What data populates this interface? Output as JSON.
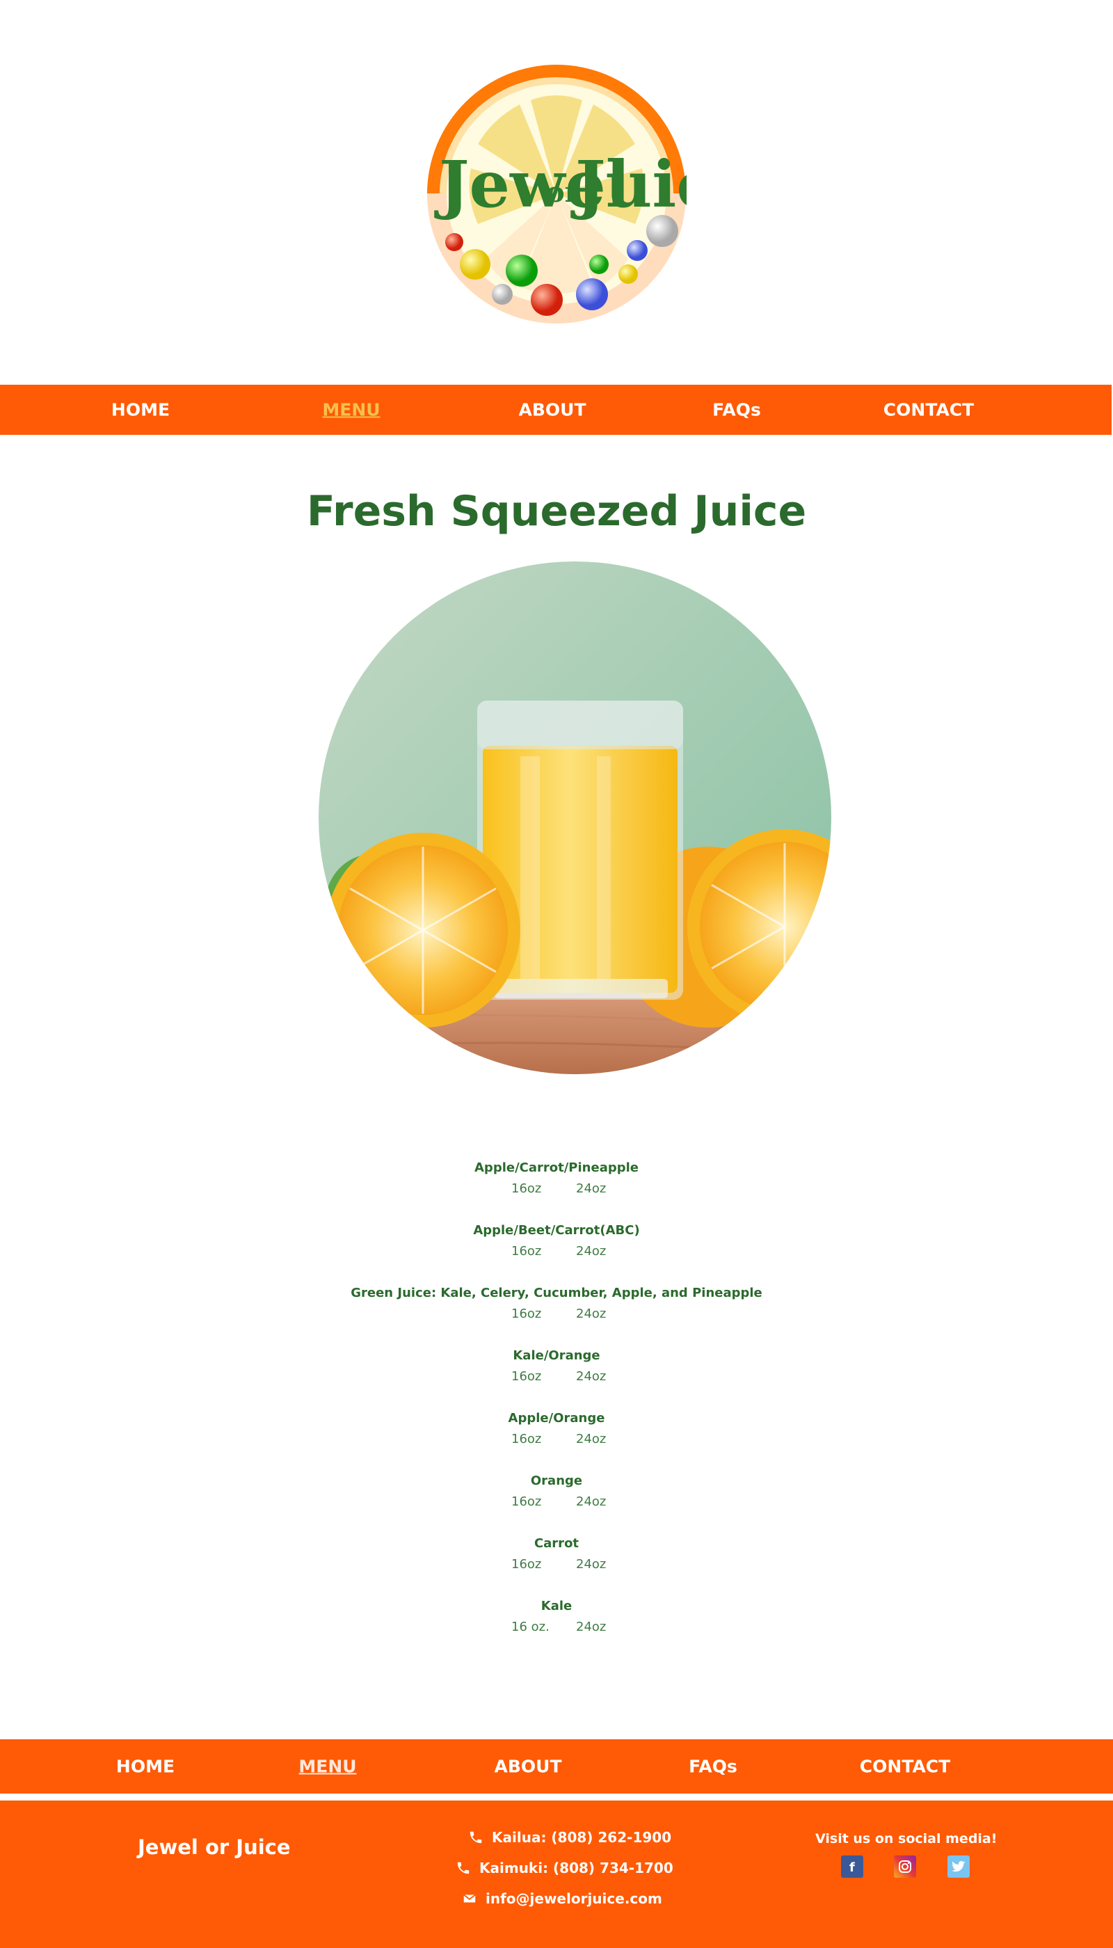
{
  "logo": {
    "word1": "Jewel",
    "word2": "or",
    "word3": "Juice"
  },
  "nav": {
    "items": [
      {
        "label": "HOME",
        "active": false
      },
      {
        "label": "MENU",
        "active": true
      },
      {
        "label": "ABOUT",
        "active": false
      },
      {
        "label": "FAQs",
        "active": false
      },
      {
        "label": "CONTACT",
        "active": false
      }
    ]
  },
  "page": {
    "title": "Fresh Squeezed Juice"
  },
  "menu": {
    "items": [
      {
        "name": "Apple/Carrot/Pineapple",
        "size1": "16oz",
        "size2": "24oz"
      },
      {
        "name": "Apple/Beet/Carrot(ABC)",
        "size1": "16oz",
        "size2": "24oz"
      },
      {
        "name": "Green Juice: Kale, Celery, Cucumber, Apple, and Pineapple",
        "size1": "16oz",
        "size2": "24oz"
      },
      {
        "name": "Kale/Orange",
        "size1": "16oz",
        "size2": "24oz"
      },
      {
        "name": "Apple/Orange",
        "size1": "16oz",
        "size2": "24oz"
      },
      {
        "name": "Orange",
        "size1": "16oz",
        "size2": "24oz"
      },
      {
        "name": "Carrot",
        "size1": "16oz",
        "size2": "24oz"
      },
      {
        "name": "Kale",
        "size1": "16 oz.",
        "size2": "24oz"
      }
    ]
  },
  "footer": {
    "brand": "Jewel or Juice",
    "phone_kailua": "Kailua: (808) 262-1900",
    "phone_kaimuki": "Kaimuki: (808) 734-1700",
    "email": "info@jewelorjuice.com",
    "social_label": "Visit us on social media!",
    "social": [
      "facebook-icon",
      "instagram-icon",
      "twitter-icon"
    ]
  },
  "colors": {
    "brand_orange": "#ff5a05",
    "brand_green": "#2b6a2d",
    "active_nav": "#f7c04d"
  }
}
